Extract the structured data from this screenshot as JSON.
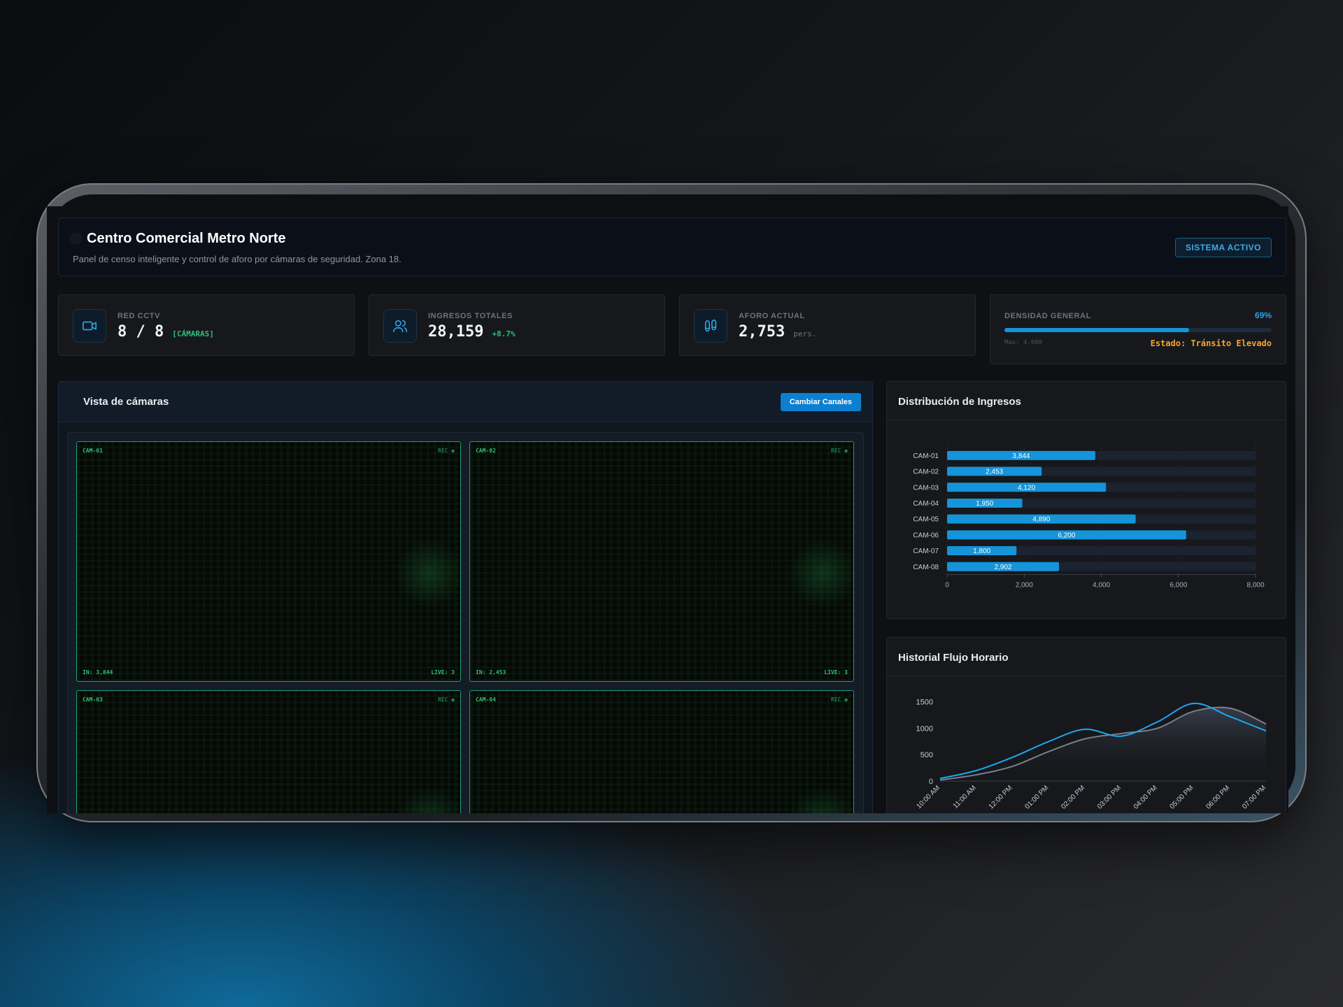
{
  "header": {
    "title": "Centro Comercial Metro Norte",
    "subtitle": "Panel de censo inteligente y control de aforo por cámaras de seguridad. Zona 18.",
    "status_badge": "SISTEMA ACTIVO"
  },
  "stats": {
    "cctv": {
      "icon": "video-camera-icon",
      "label": "RED CCTV",
      "value": "8 / 8",
      "suffix": "[CÁMARAS]",
      "suffix_color": "#2ebf7a"
    },
    "ingresos": {
      "icon": "users-icon",
      "label": "INGRESOS TOTALES",
      "value": "28,159",
      "suffix": "+8.7%",
      "suffix_color": "#2ebf7a"
    },
    "aforo": {
      "icon": "footprints-icon",
      "label": "AFORO ACTUAL",
      "value": "2,753",
      "suffix": "pers.",
      "suffix_color": "#6d7480"
    },
    "densidad": {
      "label": "DENSIDAD GENERAL",
      "percent_text": "69%",
      "level": 0.69,
      "max_text": "Max: 4,000",
      "state_text": "Estado: Tránsito Elevado",
      "state_color": "#f4a430"
    }
  },
  "cameras_panel": {
    "title": "Vista de cámaras",
    "button_label": "Cambiar Canales",
    "feeds": [
      {
        "id": "CAM-01",
        "rec": "REC ●",
        "in_text": "IN: 3,844",
        "live_text": "LIVE: 3"
      },
      {
        "id": "CAM-02",
        "rec": "REC ●",
        "in_text": "IN: 2,453",
        "live_text": "LIVE: 3"
      },
      {
        "id": "CAM-03",
        "rec": "REC ●",
        "in_text": "",
        "live_text": ""
      },
      {
        "id": "CAM-04",
        "rec": "REC ●",
        "in_text": "",
        "live_text": ""
      }
    ]
  },
  "distribution": {
    "title": "Distribución de Ingresos"
  },
  "history": {
    "title": "Historial Flujo Horario"
  },
  "colors": {
    "accent": "#1594d9",
    "bar": "#1594d9",
    "line_primary": "#1ea7ee",
    "line_secondary": "#7b7f87",
    "success": "#2ebf7a",
    "warning": "#f4a430"
  },
  "chart_data": [
    {
      "type": "bar",
      "orientation": "horizontal",
      "title": "Distribución de Ingresos",
      "categories": [
        "CAM-01",
        "CAM-02",
        "CAM-03",
        "CAM-04",
        "CAM-05",
        "CAM-06",
        "CAM-07",
        "CAM-08"
      ],
      "values": [
        3844,
        2453,
        4120,
        1950,
        4890,
        6200,
        1800,
        2902
      ],
      "value_labels": [
        "3,844",
        "2,453",
        "4,120",
        "1,950",
        "4,890",
        "6,200",
        "1,800",
        "2,902"
      ],
      "xlim": [
        0,
        8000
      ],
      "x_ticks": [
        "0",
        "2,000",
        "4,000",
        "6,000",
        "8,000"
      ],
      "grid": true
    },
    {
      "type": "area",
      "title": "Historial Flujo Horario",
      "x": [
        "10:00 AM",
        "11:00 AM",
        "12:00 PM",
        "01:00 PM",
        "02:00 PM",
        "03:00 PM",
        "04:00 PM",
        "05:00 PM",
        "06:00 PM",
        "07:00 PM"
      ],
      "y_ticks": [
        "0",
        "500",
        "1000",
        "1500"
      ],
      "ylim": [
        0,
        1600
      ],
      "series": [
        {
          "values": [
            50,
            200,
            450,
            750,
            980,
            850,
            1120,
            1470,
            1220,
            950
          ]
        },
        {
          "values": [
            20,
            120,
            280,
            560,
            800,
            900,
            1000,
            1320,
            1380,
            1080
          ]
        }
      ]
    }
  ]
}
